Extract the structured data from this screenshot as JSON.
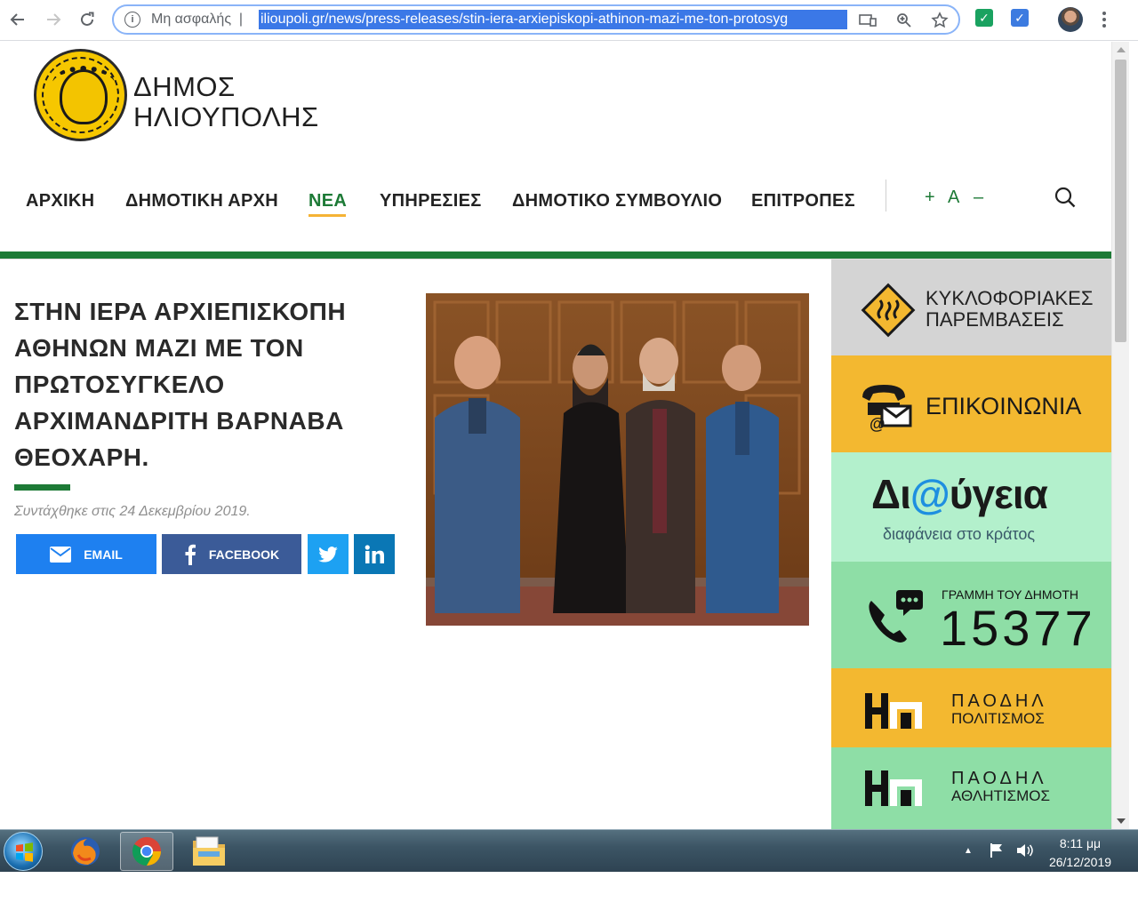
{
  "browser": {
    "security_label": "Μη ασφαλής",
    "url": "ilioupoli.gr/news/press-releases/stin-iera-arxiepiskopi-athinon-mazi-me-ton-protosyg"
  },
  "site": {
    "logo_line1": "ΔΗΜΟΣ",
    "logo_line2": "ΗΛΙΟΥΠΟΛΗΣ"
  },
  "nav": {
    "items": [
      "ΑΡΧΙΚΗ",
      "ΔΗΜΟΤΙΚΗ ΑΡΧΗ",
      "ΝΕΑ",
      "ΥΠΗΡΕΣΙΕΣ",
      "ΔΗΜΟΤΙΚΟ ΣΥΜΒΟΥΛΙΟ",
      "ΕΠΙΤΡΟΠΕΣ"
    ],
    "active": "ΝΕΑ",
    "font_increase": "+",
    "font_reset": "A",
    "font_decrease": "–"
  },
  "article": {
    "title_lines": [
      "ΣΤΗΝ ΙΕΡΑ ΑΡΧΙΕΠΙΣΚΟΠΗ",
      "ΑΘΗΝΩΝ ΜΑΖΙ ΜΕ ΤΟΝ",
      "ΠΡΩΤΟΣΥΓΚΕΛΟ",
      "ΑΡΧΙΜΑΝΔΡΙΤΗ ΒΑΡΝΑΒΑ",
      "ΘΕΟΧΑΡΗ."
    ],
    "date": "Συντάχθηκε στις 24 Δεκεμβρίου 2019.",
    "share_email": "EMAIL",
    "share_facebook": "FACEBOOK"
  },
  "sidebar": {
    "traffic_line1": "ΚΥΚΛΟΦΟΡΙΑΚΕΣ",
    "traffic_line2": "ΠΑΡΕΜΒΑΣΕΙΣ",
    "contact": "ΕΠΙΚΟΙΝΩΝΙΑ",
    "diavgeia_pre": "Δι",
    "diavgeia_at": "@",
    "diavgeia_post": "ύγεια",
    "diavgeia_sub": "διαφάνεια στο κράτος",
    "hotline_label": "ΓΡΑΜΜΗ ΤΟΥ ΔΗΜΟΤΗ",
    "hotline_number": "15377",
    "paodhl_culture_name": "ΠΑΟΔΗΛ",
    "paodhl_culture_sub": "ΠΟΛΙΤΙΣΜΟΣ",
    "paodhl_sport_name": "ΠΑΟΔΗΛ",
    "paodhl_sport_sub": "ΑΘΛΗΤΙΣΜΟΣ"
  },
  "taskbar": {
    "time": "8:11 μμ",
    "date": "26/12/2019"
  },
  "colors": {
    "brand_green": "#1d7a36",
    "accent_orange": "#f5b335",
    "sidebar_yellow": "#f3b830",
    "sidebar_mint": "#b3f0cc",
    "sidebar_green": "#8edea6"
  }
}
